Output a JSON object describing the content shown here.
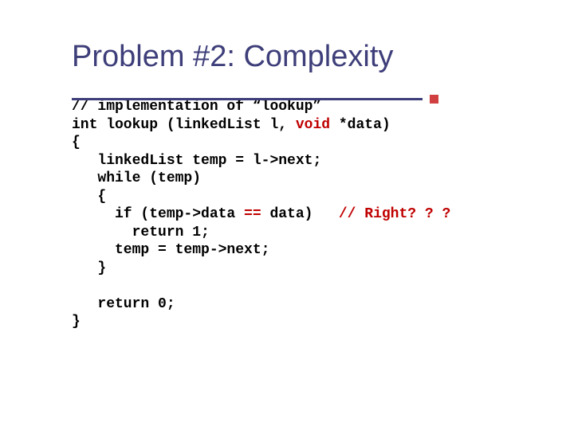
{
  "title": "Problem #2: Complexity",
  "code": {
    "l01a": "// implementation of “lookup”",
    "l02a": "int lookup (linkedList l, ",
    "l02b": "void",
    "l02c": " *data)",
    "l03a": "{",
    "l04a": "   linkedList temp = l->next;",
    "l05a": "   while (temp)",
    "l06a": "   {",
    "l07a": "     if (temp->data ",
    "l07b": "==",
    "l07c": " data)   ",
    "l07d": "// Right? ? ?",
    "l08a": "       return 1;",
    "l09a": "     temp = temp->next;",
    "l10a": "   }",
    "l11a": "",
    "l12a": "   return 0;",
    "l13a": "}"
  }
}
